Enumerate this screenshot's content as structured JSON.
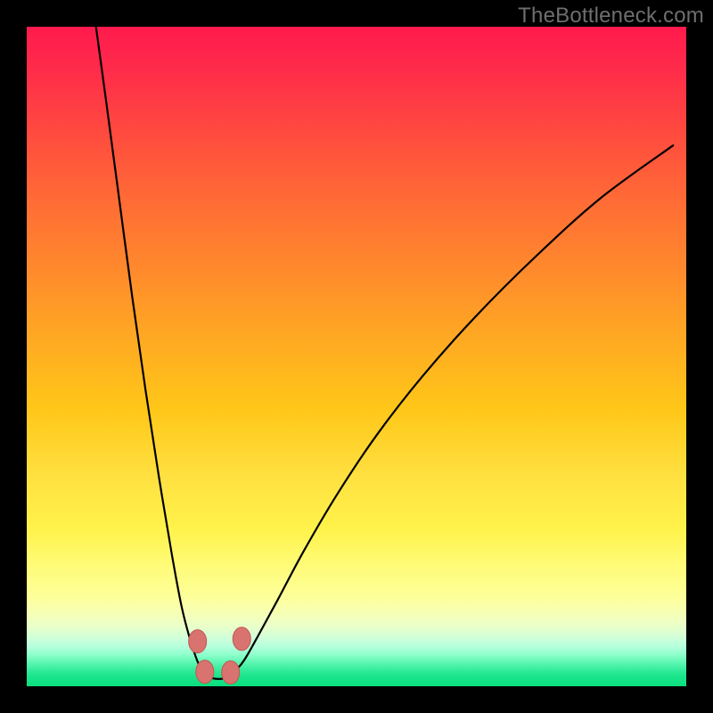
{
  "watermark": "TheBottleneck.com",
  "colors": {
    "frame": "#000000",
    "curve": "#000000",
    "marker_fill": "#d8736f",
    "marker_stroke": "#c55651",
    "gradient_top": "#ff1a4d",
    "gradient_bottom": "#0adf7e"
  },
  "chart_data": {
    "type": "line",
    "title": "",
    "xlabel": "",
    "ylabel": "",
    "xlim": [
      0,
      100
    ],
    "ylim": [
      0,
      100
    ],
    "grid": false,
    "legend": false,
    "note": "Bottleneck-style V-curve. No numeric axes or labels visible; values estimated from pixel positions on a 0–100 normalized grid.",
    "series": [
      {
        "name": "left-branch",
        "x": [
          10.5,
          12,
          14,
          16,
          18,
          20,
          22,
          23.5,
          24.8,
          25.8,
          26.5
        ],
        "y": [
          100,
          89,
          74,
          59,
          45,
          32,
          20,
          12,
          7,
          4,
          2.5
        ]
      },
      {
        "name": "trough",
        "x": [
          26.5,
          27.3,
          28.2,
          29.1,
          30,
          30.9,
          31.8
        ],
        "y": [
          2.5,
          1.6,
          1.2,
          1.1,
          1.2,
          1.6,
          2.5
        ]
      },
      {
        "name": "right-branch",
        "x": [
          31.8,
          33,
          35,
          38,
          42,
          47,
          53,
          60,
          68,
          77,
          87,
          98
        ],
        "y": [
          2.5,
          4,
          7.5,
          13,
          20.5,
          29,
          38,
          47,
          56,
          65,
          74,
          82
        ]
      }
    ],
    "markers": [
      {
        "x": 25.9,
        "y": 6.8
      },
      {
        "x": 27.0,
        "y": 2.2
      },
      {
        "x": 30.9,
        "y": 2.1
      },
      {
        "x": 32.6,
        "y": 7.2
      }
    ]
  }
}
